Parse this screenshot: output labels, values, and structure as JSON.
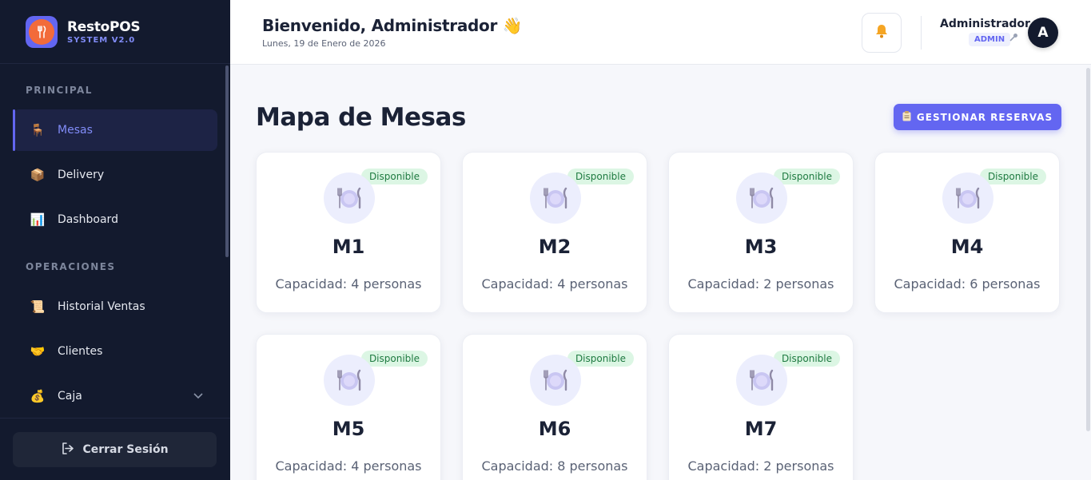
{
  "brand": {
    "name": "RestoPOS",
    "sub": "SYSTEM V2.0",
    "logo_icon": "fork-knife-icon"
  },
  "sidebar": {
    "sections": [
      {
        "heading": "PRINCIPAL"
      },
      {
        "heading": "OPERACIONES"
      }
    ],
    "items": [
      {
        "label": "Mesas",
        "icon": "🪑",
        "active": true
      },
      {
        "label": "Delivery",
        "icon": "📦"
      },
      {
        "label": "Dashboard",
        "icon": "📊"
      },
      {
        "label": "Historial Ventas",
        "icon": "📜"
      },
      {
        "label": "Clientes",
        "icon": "🤝"
      },
      {
        "label": "Caja",
        "icon": "💰"
      }
    ],
    "logout_label": "Cerrar Sesión"
  },
  "header": {
    "welcome": "Bienvenido, Administrador 👋",
    "date": "Lunes, 19 de Enero de 2026",
    "user_name": "Administrador",
    "role": "ADMIN",
    "avatar_initial": "A"
  },
  "main": {
    "title": "Mapa de Mesas",
    "reserve_button": "GESTIONAR RESERVAS",
    "tables": [
      {
        "name": "M1",
        "status": "Disponible",
        "capacity": "Capacidad: 4 personas"
      },
      {
        "name": "M2",
        "status": "Disponible",
        "capacity": "Capacidad: 4 personas"
      },
      {
        "name": "M3",
        "status": "Disponible",
        "capacity": "Capacidad: 2 personas"
      },
      {
        "name": "M4",
        "status": "Disponible",
        "capacity": "Capacidad: 6 personas"
      },
      {
        "name": "M5",
        "status": "Disponible",
        "capacity": "Capacidad: 4 personas"
      },
      {
        "name": "M6",
        "status": "Disponible",
        "capacity": "Capacidad: 8 personas"
      },
      {
        "name": "M7",
        "status": "Disponible",
        "capacity": "Capacidad: 2 personas"
      }
    ]
  },
  "colors": {
    "accent": "#6366f1",
    "sidebar_bg": "#131a2e",
    "available": "#dcf6e4"
  }
}
